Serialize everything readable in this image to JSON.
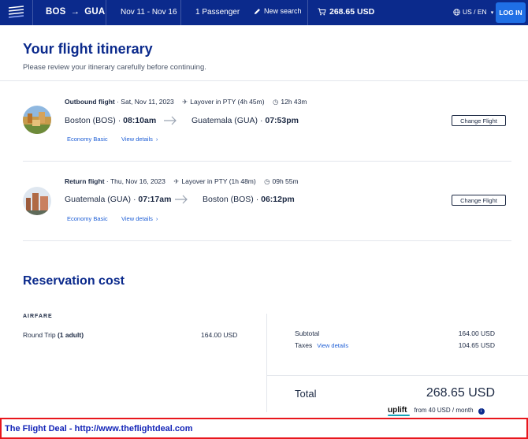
{
  "header": {
    "origin": "BOS",
    "destination": "GUA",
    "dates": "Nov 11 - Nov 16",
    "passengers": "1 Passenger",
    "new_search_label": "New search",
    "cart_total": "268.65 USD",
    "locale": "US / EN",
    "login_label": "LOG IN"
  },
  "page": {
    "title": "Your flight itinerary",
    "subtitle": "Please review your itinerary carefully before continuing."
  },
  "flights": [
    {
      "label": "Outbound flight",
      "date": "Sat, Nov 11, 2023",
      "layover": "Layover in PTY (4h 45m)",
      "duration": "12h 43m",
      "from_city": "Boston (BOS)",
      "from_time": "08:10am",
      "to_city": "Guatemala (GUA)",
      "to_time": "07:53pm",
      "fare": "Economy Basic",
      "details_label": "View details",
      "change_label": "Change Flight"
    },
    {
      "label": "Return flight",
      "date": "Thu, Nov 16, 2023",
      "layover": "Layover in PTY (1h 48m)",
      "duration": "09h 55m",
      "from_city": "Guatemala (GUA)",
      "from_time": "07:17am",
      "to_city": "Boston (BOS)",
      "to_time": "06:12pm",
      "fare": "Economy Basic",
      "details_label": "View details",
      "change_label": "Change Flight"
    }
  ],
  "reservation": {
    "title": "Reservation cost",
    "airfare_label": "AIRFARE",
    "trip_type": "Round Trip",
    "travelers": "(1 adult)",
    "trip_amount": "164.00 USD",
    "subtotal_label": "Subtotal",
    "subtotal_amount": "164.00 USD",
    "taxes_label": "Taxes",
    "taxes_details_label": "View details",
    "taxes_amount": "104.65 USD",
    "total_label": "Total",
    "total_amount": "268.65 USD",
    "uplift_brand": "uplift",
    "uplift_text": "from 40 USD / month"
  },
  "watermark": "The Flight Deal - http://www.theflightdeal.com",
  "colors": {
    "header_bg": "#0b2a8c",
    "accent_blue": "#1f6fe5",
    "link_blue": "#1f5fd6",
    "watermark_border": "#e8161c",
    "watermark_text": "#1425b8"
  }
}
